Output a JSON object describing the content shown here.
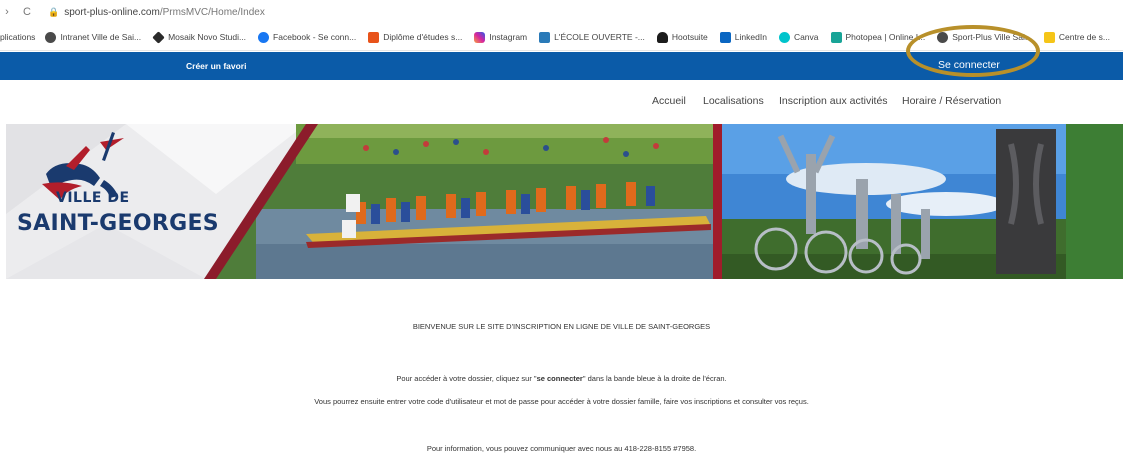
{
  "browser": {
    "back_glyph": "›",
    "reload_glyph": "C",
    "lock_glyph": "🔒",
    "url_host": "sport-plus-online.com",
    "url_path": "/PrmsMVC/Home/Index"
  },
  "bookmarks": [
    {
      "label": "plications",
      "color": ""
    },
    {
      "label": "Intranet Ville de Sai...",
      "color": "#4a4a4a"
    },
    {
      "label": "Mosaik Novo Studi...",
      "color": "#2b2b2b"
    },
    {
      "label": "Facebook - Se conn...",
      "color": "#1877f2"
    },
    {
      "label": "Diplôme d'études s...",
      "color": "#e8531a"
    },
    {
      "label": "Instagram",
      "color": "#d6249f"
    },
    {
      "label": "L'ÉCOLE OUVERTE -...",
      "color": "#2a7ab8"
    },
    {
      "label": "Hootsuite",
      "color": "#1c1c1c"
    },
    {
      "label": "LinkedIn",
      "color": "#0a66c2"
    },
    {
      "label": "Canva",
      "color": "#00c4cc"
    },
    {
      "label": "Photopea | Online I...",
      "color": "#18a497"
    },
    {
      "label": "Sport-Plus Ville Sai...",
      "color": "#4a4a4a"
    },
    {
      "label": "Centre de s...",
      "color": "#f5c518"
    }
  ],
  "band": {
    "favorite_link": "Créer un favori",
    "connect_link": "Se connecter",
    "accent_color": "#0b5ba8",
    "highlight_color": "#b8902a"
  },
  "nav": {
    "home": "Accueil",
    "locations": "Localisations",
    "registration": "Inscription aux activités",
    "schedule": "Horaire / Réservation"
  },
  "logo": {
    "line1": "VILLE DE",
    "line2": "SAINT-GEORGES"
  },
  "content": {
    "welcome": "BIENVENUE SUR LE SITE D'INSCRIPTION EN LIGNE DE VILLE DE SAINT-GEORGES",
    "access_before": "Pour accéder à votre dossier, cliquez sur \"",
    "access_bold": "se connecter",
    "access_after": "\" dans la bande bleue à la droite de l'écran.",
    "instructions": "Vous pourrez ensuite entrer votre code d'utilisateur et mot de passe pour accéder à votre dossier famille, faire vos inscriptions et consulter vos reçus.",
    "contact": "Pour information, vous pouvez communiquer avec nous au 418-228-8155  #7958."
  }
}
